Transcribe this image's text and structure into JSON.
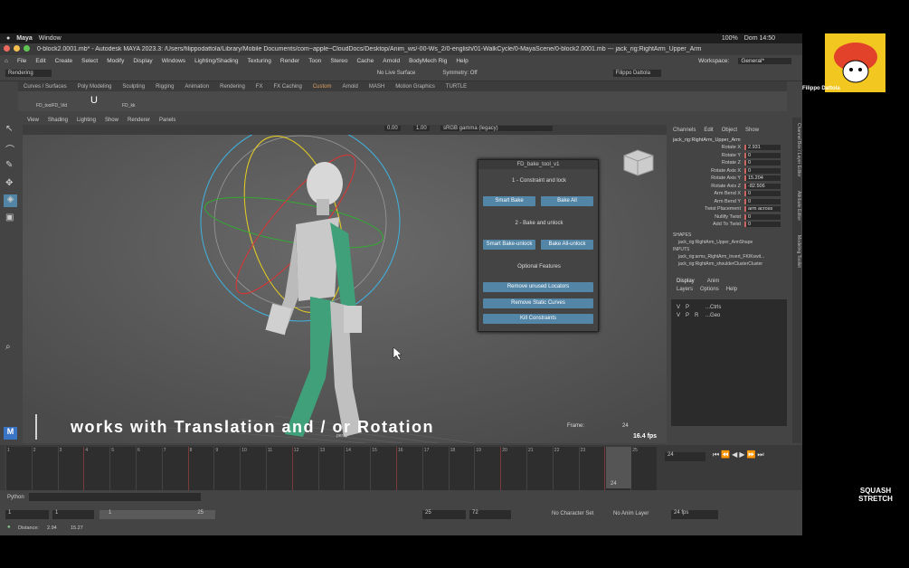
{
  "macbar": {
    "apple": "",
    "app": "Maya",
    "window": "Window",
    "battery": "100%",
    "clock": "Dom 14:50"
  },
  "title": "0-block2.0001.mb* - Autodesk MAYA 2023.3: /Users/filippodattola/Library/Mobile Documents/com~apple~CloudDocs/Desktop/Anim_ws/-00-Ws_2/0-english/01-WalkCycle/0-MayaScene/0-block2.0001.mb --- jack_rig:RightArm_Upper_Arm",
  "menus": [
    "File",
    "Edit",
    "Create",
    "Select",
    "Modify",
    "Display",
    "Windows",
    "Lighting/Shading",
    "Texturing",
    "Render",
    "Toon",
    "Stereo",
    "Cache",
    "Arnold",
    "BodyMech Rig",
    "Help"
  ],
  "workspace": {
    "label": "Workspace:",
    "value": "General*"
  },
  "status": {
    "mode": "Rendering",
    "live": "No Live Surface",
    "symmetry": "Symmetry: Off",
    "user": "Filippo Dattola"
  },
  "shelf_tabs": [
    "Curves / Surfaces",
    "Poly Modeling",
    "Sculpting",
    "Rigging",
    "Animation",
    "Rendering",
    "FX",
    "FX Caching",
    "Custom",
    "Arnold",
    "MASH",
    "Motion Graphics",
    "TURTLE"
  ],
  "shelf_icons": [
    "FD_toolFD_Vid",
    "U",
    "FD_kk"
  ],
  "vp_menu": [
    "View",
    "Shading",
    "Lighting",
    "Show",
    "Renderer",
    "Panels"
  ],
  "vp_values": {
    "exposure": "0.00",
    "gamma": "1.00",
    "colorspace": "sRGB gamma (legacy)"
  },
  "hud": {
    "frame_label": "Frame:",
    "frame": "24",
    "fps": "16.4 fps",
    "cam": "persp"
  },
  "dialog": {
    "title": "FD_bake_tool_v1",
    "sec1": "1 - Constraint and lock",
    "smart_bake": "Smart Bake",
    "bake_all": "Bake All",
    "sec2": "2 - Bake and unlock",
    "smart_unlock": "Smart Bake-unlock",
    "bake_all_unlock": "Bake All-unlock",
    "sec3": "Optional Features",
    "remove_locators": "Remove unused Locators",
    "remove_curves": "Remove Static Curves",
    "kill_constraints": "Kill Constraints"
  },
  "channel_tabs": [
    "Channels",
    "Edit",
    "Object",
    "Show"
  ],
  "channel_object": "jack_rig:RightArm_Upper_Arm",
  "channels": [
    {
      "n": "Rotate X",
      "v": "2.931"
    },
    {
      "n": "Rotate Y",
      "v": "0"
    },
    {
      "n": "Rotate Z",
      "v": "0"
    },
    {
      "n": "Rotate Axis X",
      "v": "0"
    },
    {
      "n": "Rotate Axis Y",
      "v": "15.204"
    },
    {
      "n": "Rotate Axis Z",
      "v": "-82.506"
    },
    {
      "n": "Arm Bend X",
      "v": "0"
    },
    {
      "n": "Arm Bend Y",
      "v": "0"
    },
    {
      "n": "Twist Placement",
      "v": "arm across"
    },
    {
      "n": "Nullify Twist",
      "v": "0"
    },
    {
      "n": "Add To Twist",
      "v": "0"
    }
  ],
  "shapes_label": "SHAPES",
  "shape": "jack_rig:RightArm_Upper_ArmShape",
  "inputs_label": "INPUTS",
  "inputs": [
    "jack_rig:arms_RightArm_Invert_FKIKswit...",
    "jack_rig:RightArm_shoulderClusterCluster"
  ],
  "layer_tabs": [
    "Display",
    "Anim"
  ],
  "layer_menu": [
    "Layers",
    "Options",
    "Help"
  ],
  "layers": [
    {
      "v": "V",
      "p": "P",
      "r": "",
      "name": "...Ctrls"
    },
    {
      "v": "V",
      "p": "P",
      "r": "R",
      "name": "...Geo"
    }
  ],
  "side_tabs": [
    "Channel Box / Layer Editor",
    "Attribute Editor",
    "Modeling Toolkit"
  ],
  "timeline": {
    "ticks": [
      "1",
      "2",
      "3",
      "4",
      "5",
      "6",
      "7",
      "8",
      "9",
      "10",
      "11",
      "12",
      "13",
      "14",
      "15",
      "16",
      "17",
      "18",
      "19",
      "20",
      "21",
      "22",
      "23",
      "24",
      "25"
    ],
    "current": "24",
    "current_field": "24"
  },
  "python_label": "Python",
  "range": {
    "start": "1",
    "start2": "1",
    "r1": "1",
    "r2": "25",
    "end1": "25",
    "end2": "72",
    "charset": "No Character Set",
    "animlayer": "No Anim Layer",
    "fps": "24 fps"
  },
  "distance": {
    "label": "Distance:",
    "a": "2.94",
    "b": "15.27"
  },
  "caption": "works with Translation and / or Rotation",
  "webcam": {
    "name": "Filippo Dattola"
  },
  "logo": "SQUASH STRETCH"
}
